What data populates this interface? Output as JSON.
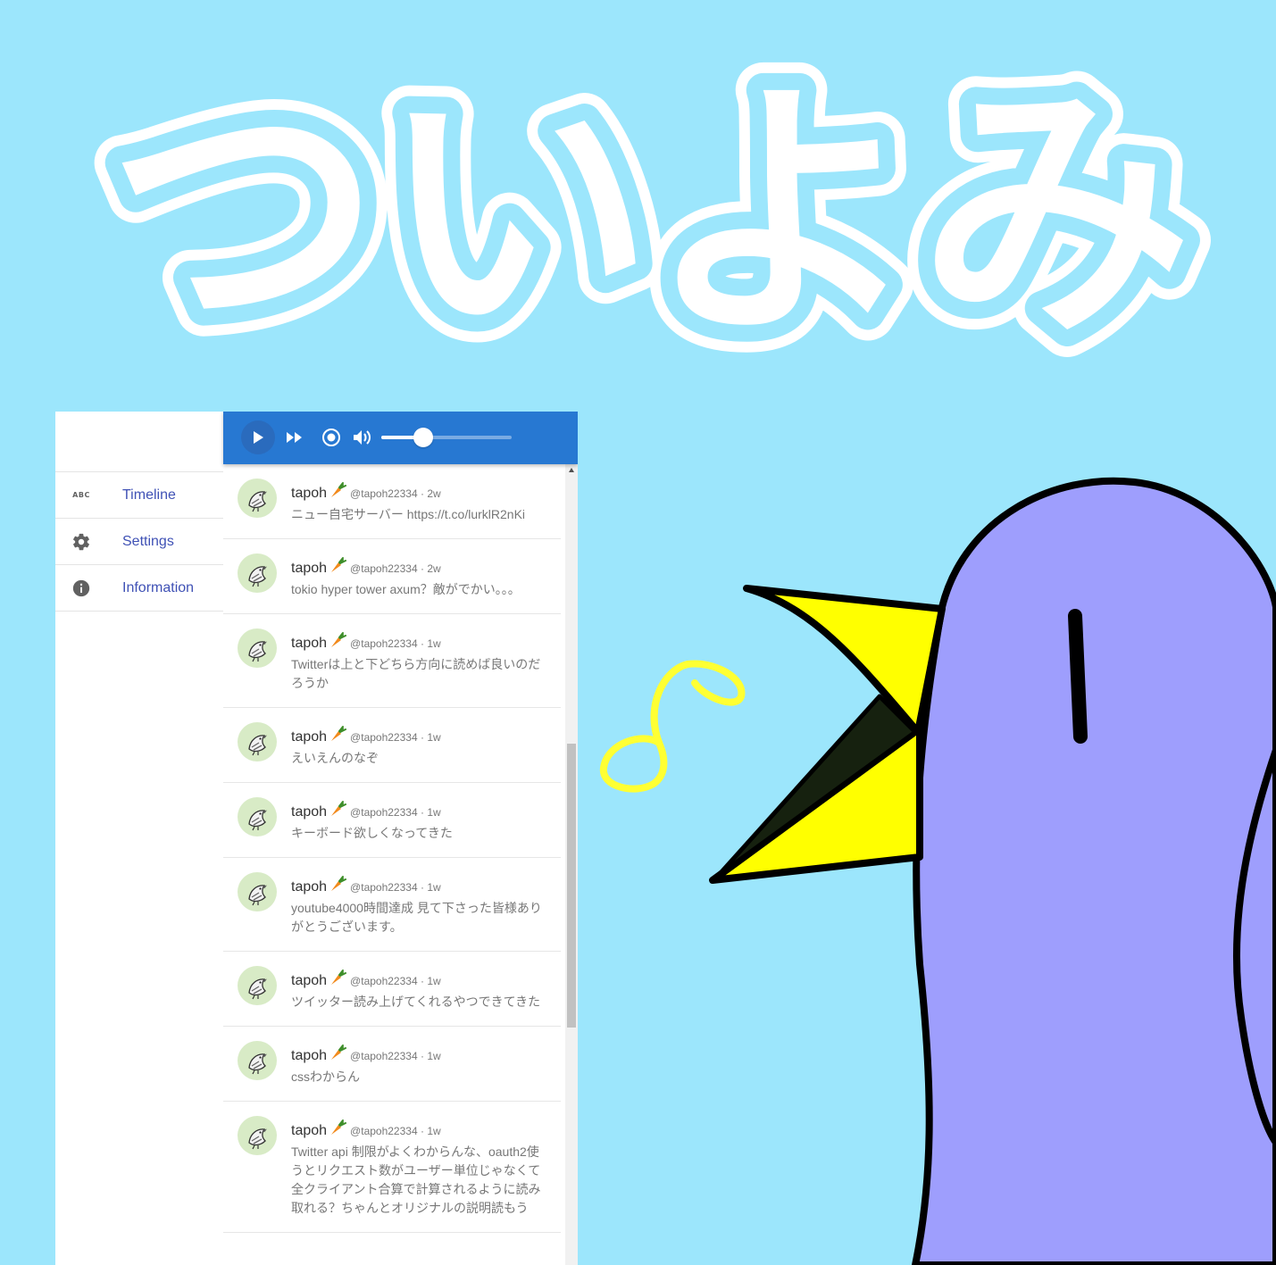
{
  "logo": {
    "text": "ついよみ"
  },
  "sidebar": {
    "items": [
      {
        "icon": "abc-icon",
        "icon_text": "ABC",
        "label": "Timeline"
      },
      {
        "icon": "gear-icon",
        "label": "Settings"
      },
      {
        "icon": "info-icon",
        "label": "Information"
      }
    ]
  },
  "player": {
    "volume_level": 0.32
  },
  "colors": {
    "background": "#9ce6fc",
    "player_bar": "#2778d2",
    "nav_text": "#3f51b5",
    "bird_body": "#9e9efd",
    "beak": "#ffff00",
    "note": "#ffff33"
  },
  "tweets": [
    {
      "name": "tapoh",
      "handle": "@tapoh22334",
      "time": "2w",
      "text": "ニュー自宅サーバー https://t.co/lurklR2nKi"
    },
    {
      "name": "tapoh",
      "handle": "@tapoh22334",
      "time": "2w",
      "text": "tokio hyper tower axum？敵がでかい。。。"
    },
    {
      "name": "tapoh",
      "handle": "@tapoh22334",
      "time": "1w",
      "text": "Twitterは上と下どちら方向に読めば良いのだろうか"
    },
    {
      "name": "tapoh",
      "handle": "@tapoh22334",
      "time": "1w",
      "text": "えいえんのなぞ"
    },
    {
      "name": "tapoh",
      "handle": "@tapoh22334",
      "time": "1w",
      "text": "キーボード欲しくなってきた"
    },
    {
      "name": "tapoh",
      "handle": "@tapoh22334",
      "time": "1w",
      "text": "youtube4000時間達成 見て下さった皆様ありがとうございます。"
    },
    {
      "name": "tapoh",
      "handle": "@tapoh22334",
      "time": "1w",
      "text": "ツイッター読み上げてくれるやつできてきた"
    },
    {
      "name": "tapoh",
      "handle": "@tapoh22334",
      "time": "1w",
      "text": "cssわからん"
    },
    {
      "name": "tapoh",
      "handle": "@tapoh22334",
      "time": "1w",
      "text": "Twitter api 制限がよくわからんな、oauth2使うとリクエスト数がユーザー単位じゃなくて全クライアント合算で計算されるように読み取れる？ちゃんとオリジナルの説明読もう"
    }
  ]
}
